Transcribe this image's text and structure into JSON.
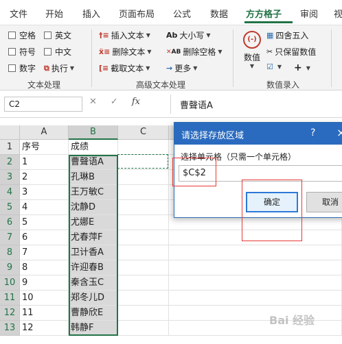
{
  "ribbon_tabs": [
    {
      "label": "文件"
    },
    {
      "label": "开始"
    },
    {
      "label": "插入"
    },
    {
      "label": "页面布局"
    },
    {
      "label": "公式"
    },
    {
      "label": "数据"
    },
    {
      "label": "方方格子",
      "active": true
    },
    {
      "label": "审阅"
    },
    {
      "label": "视"
    }
  ],
  "text_group": {
    "label": "文本处理",
    "checkboxes": [
      "空格",
      "英文",
      "符号",
      "中文",
      "数字"
    ],
    "execute_label": "执行"
  },
  "advanced_group": {
    "label": "高级文本处理",
    "insert_text": "插入文本",
    "delete_text": "删除文本",
    "extract_text": "截取文本",
    "case_label": "大小写",
    "delete_spaces": "删除空格",
    "more": "更多"
  },
  "number_group": {
    "label": "数值录入",
    "numeric": "数值",
    "round": "四舍五入",
    "keep_value": "只保留数值"
  },
  "formula_bar": {
    "name_box": "C2",
    "fx": "fx",
    "value": "曹聲语A"
  },
  "columns": [
    "A",
    "B",
    "C"
  ],
  "rows": [
    {
      "n": "1",
      "a": "序号",
      "b": "成绩"
    },
    {
      "n": "2",
      "a": "1",
      "b": "曹聲语A"
    },
    {
      "n": "3",
      "a": "2",
      "b": "孔琳B"
    },
    {
      "n": "4",
      "a": "3",
      "b": "王万敏C"
    },
    {
      "n": "5",
      "a": "4",
      "b": "沈静D"
    },
    {
      "n": "6",
      "a": "5",
      "b": "尤娜E"
    },
    {
      "n": "7",
      "a": "6",
      "b": "尤春萍F"
    },
    {
      "n": "8",
      "a": "7",
      "b": "卫计香A"
    },
    {
      "n": "9",
      "a": "8",
      "b": "许迎春B"
    },
    {
      "n": "10",
      "a": "9",
      "b": "秦含玉C"
    },
    {
      "n": "11",
      "a": "10",
      "b": "郑冬儿D"
    },
    {
      "n": "12",
      "a": "11",
      "b": "曹静欣E"
    },
    {
      "n": "13",
      "a": "12",
      "b": "韩静F"
    }
  ],
  "dialog": {
    "title": "请选择存放区域",
    "help": "?",
    "close": "×",
    "label": "选择单元格（只需一个单元格）",
    "value": "$C$2",
    "ok": "确定",
    "cancel": "取消"
  },
  "watermark": "Bai 经验",
  "colors": {
    "accent": "#217346",
    "dialog_title": "#2a6bbf",
    "annotation": "#e53935"
  }
}
